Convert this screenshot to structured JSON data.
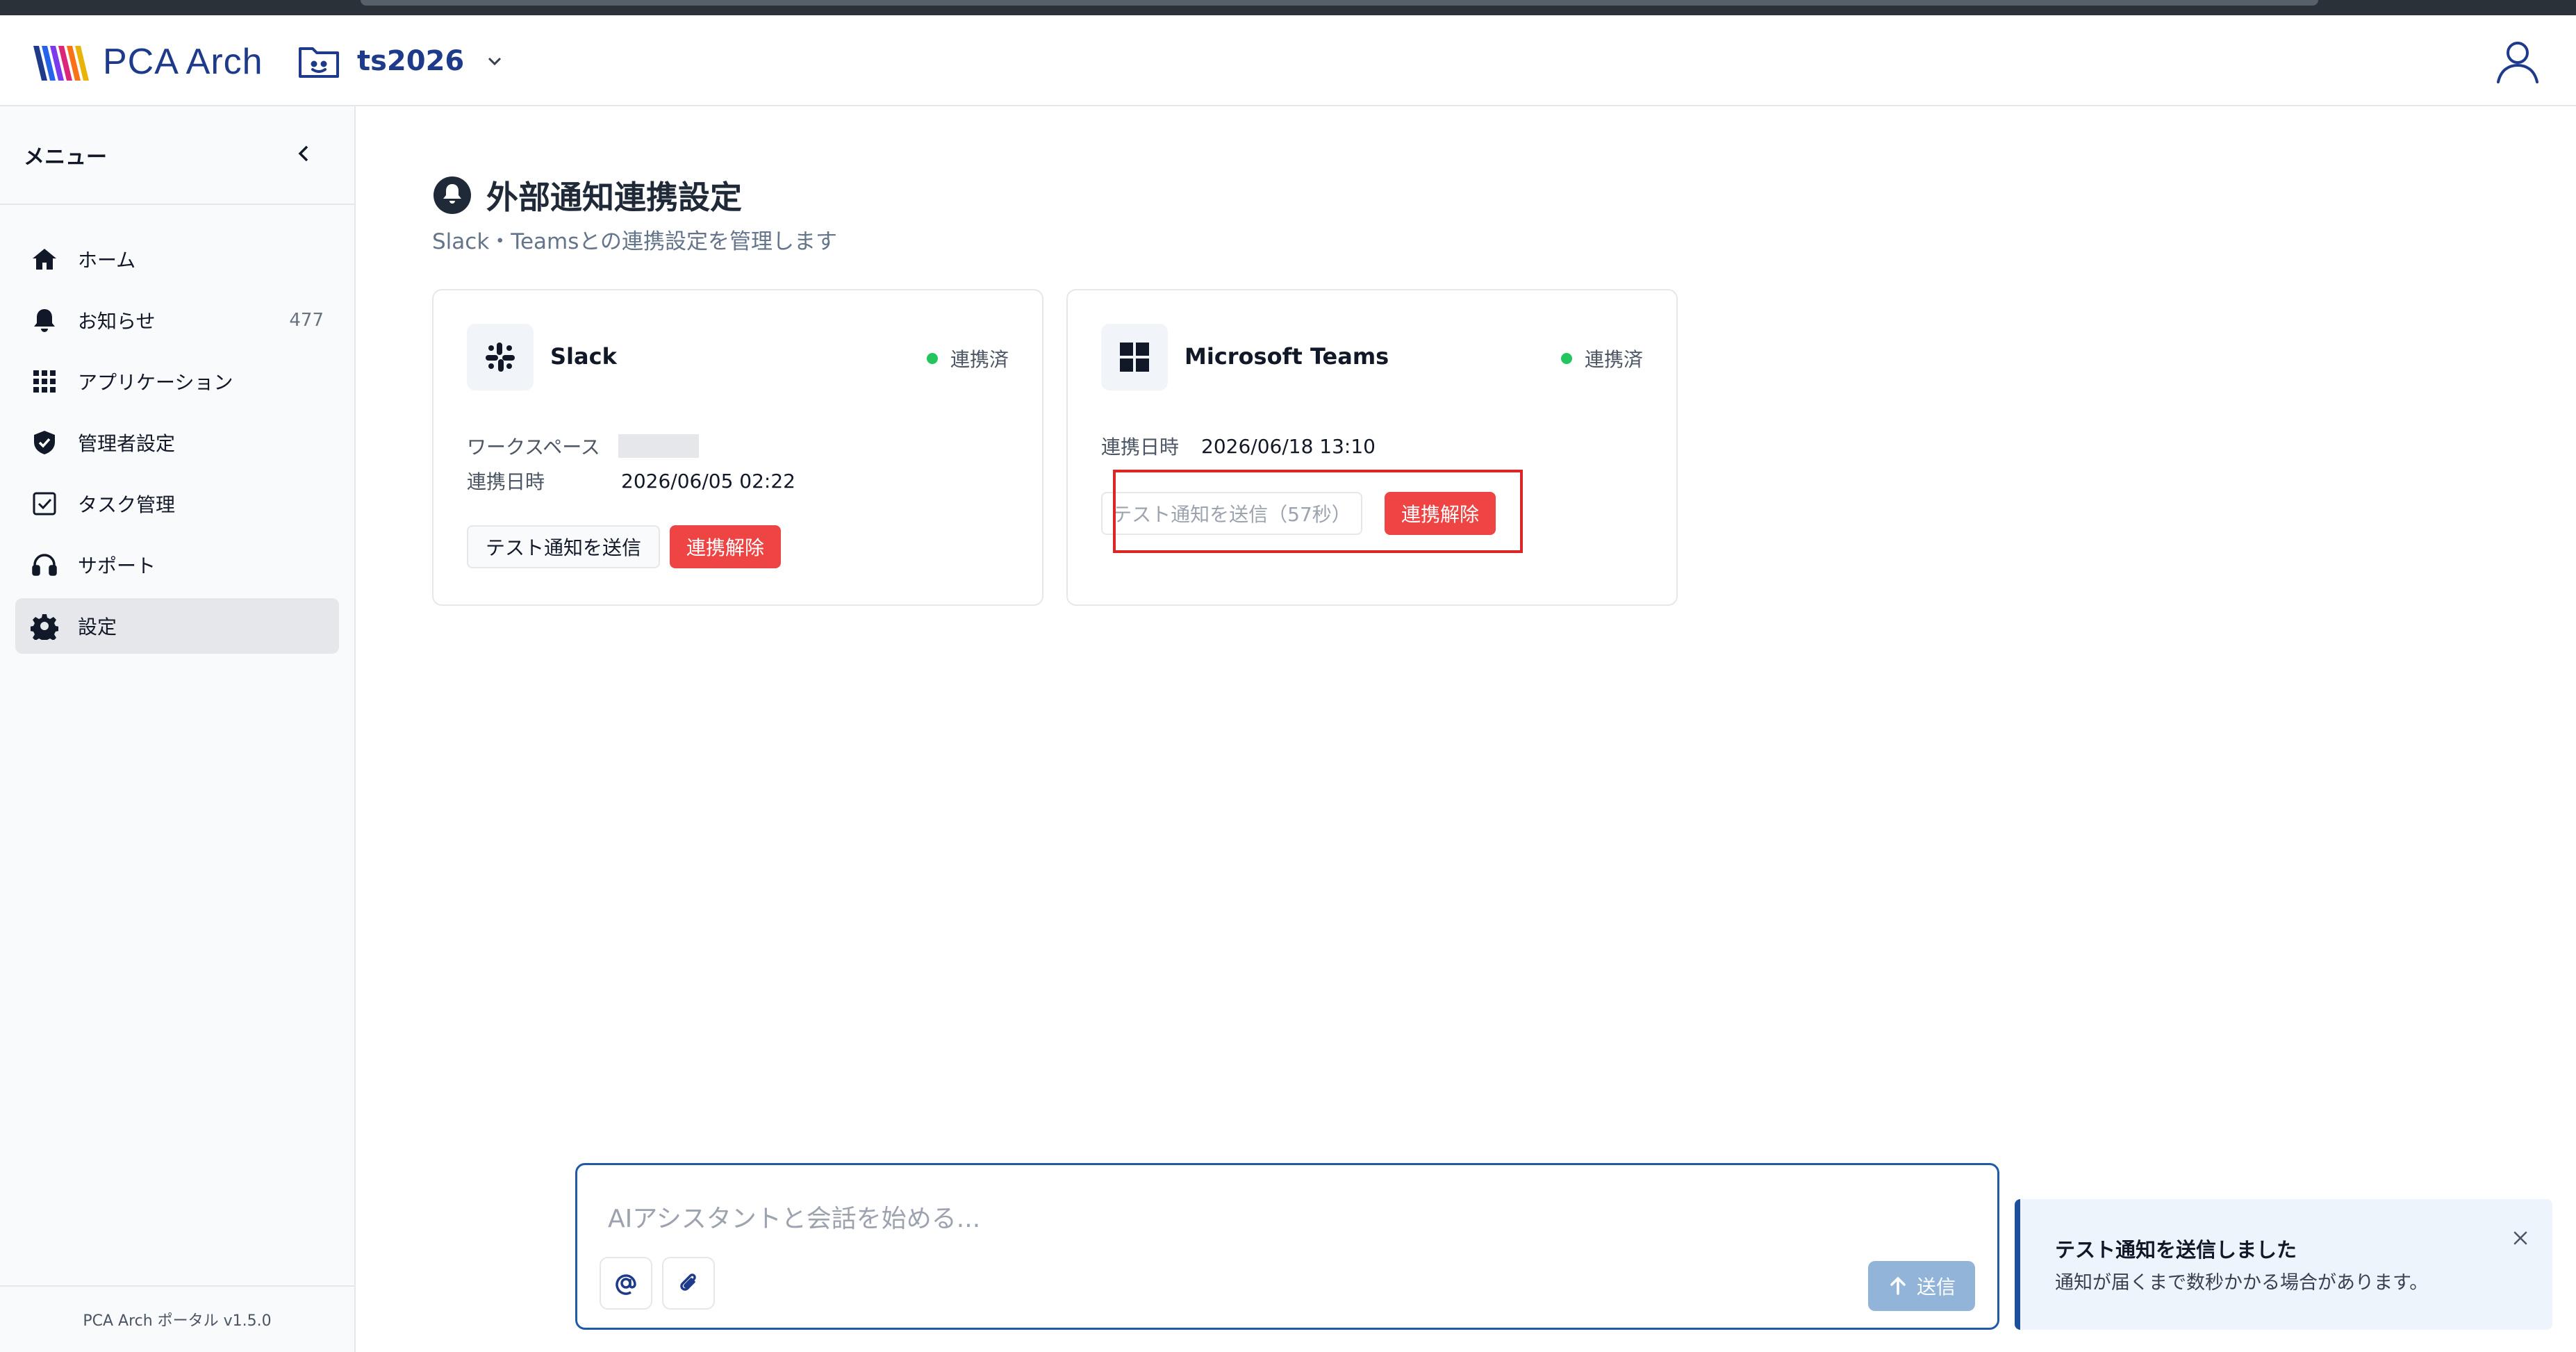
{
  "header": {
    "logo_text": "PCA Arch",
    "project_name": "ts2026"
  },
  "sidebar": {
    "title": "メニュー",
    "items": [
      {
        "label": "ホーム",
        "icon": "home-icon"
      },
      {
        "label": "お知らせ",
        "icon": "bell-icon",
        "count": "477"
      },
      {
        "label": "アプリケーション",
        "icon": "grid-icon"
      },
      {
        "label": "管理者設定",
        "icon": "shield-icon"
      },
      {
        "label": "タスク管理",
        "icon": "checkbox-icon"
      },
      {
        "label": "サポート",
        "icon": "headset-icon"
      },
      {
        "label": "設定",
        "icon": "gear-icon",
        "active": true
      }
    ],
    "footer": "PCA Arch ポータル v1.5.0"
  },
  "page": {
    "title": "外部通知連携設定",
    "subtitle": "Slack・Teamsとの連携設定を管理します"
  },
  "slack": {
    "name": "Slack",
    "status": "連携済",
    "workspace_label": "ワークスペース",
    "date_label": "連携日時",
    "date_value": "2026/06/05 02:22",
    "test_button": "テスト通知を送信",
    "disconnect_button": "連携解除"
  },
  "teams": {
    "name": "Microsoft Teams",
    "status": "連携済",
    "date_label": "連携日時",
    "date_value": "2026/06/18 13:10",
    "test_button": "テスト通知を送信（57秒）",
    "disconnect_button": "連携解除"
  },
  "chat": {
    "placeholder": "AIアシスタントと会話を始める...",
    "send_label": "送信"
  },
  "toast": {
    "title": "テスト通知を送信しました",
    "message": "通知が届くまで数秒かかる場合があります。"
  },
  "colors": {
    "brand": "#1e3a8a",
    "danger": "#ef4444",
    "connected": "#22c55e",
    "highlight": "#dc2626"
  }
}
